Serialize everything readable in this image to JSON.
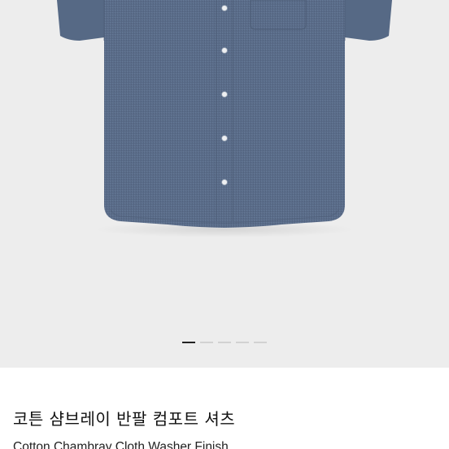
{
  "product": {
    "title_ko": "코튼 샴브레이 반팔 컴포트 셔츠",
    "title_en": "Cotton Chambray Cloth Washer Finish",
    "image_alt": "shirt-image"
  },
  "carousel": {
    "total": 5,
    "active_index": 0
  },
  "colors": {
    "background": "#ededed",
    "shirt": "#5b6e8a",
    "button": "#eef0f2",
    "dot_active": "#222222",
    "dot_inactive": "#d2d2d2"
  }
}
